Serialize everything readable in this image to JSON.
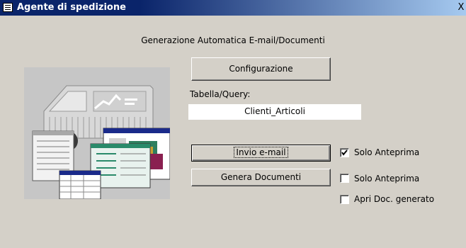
{
  "window": {
    "title": "Agente di spedizione",
    "close_glyph": "X"
  },
  "form": {
    "subtitle": "Generazione Automatica E-mail/Documenti",
    "config_button": "Configurazione",
    "table_label": "Tabella/Query:",
    "table_value": "Clienti_Articoli",
    "email_button": "Invio e-mail",
    "docs_button": "Genera Documenti",
    "email_preview_label": "Solo Anteprima",
    "email_preview_checked": true,
    "docs_preview_label": "Solo  Anteprima",
    "docs_preview_checked": false,
    "open_doc_label": "Apri Doc. generato",
    "open_doc_checked": false
  },
  "icons": {
    "window": "form-icon",
    "illustration": "delivery-van-documents-illustration"
  }
}
